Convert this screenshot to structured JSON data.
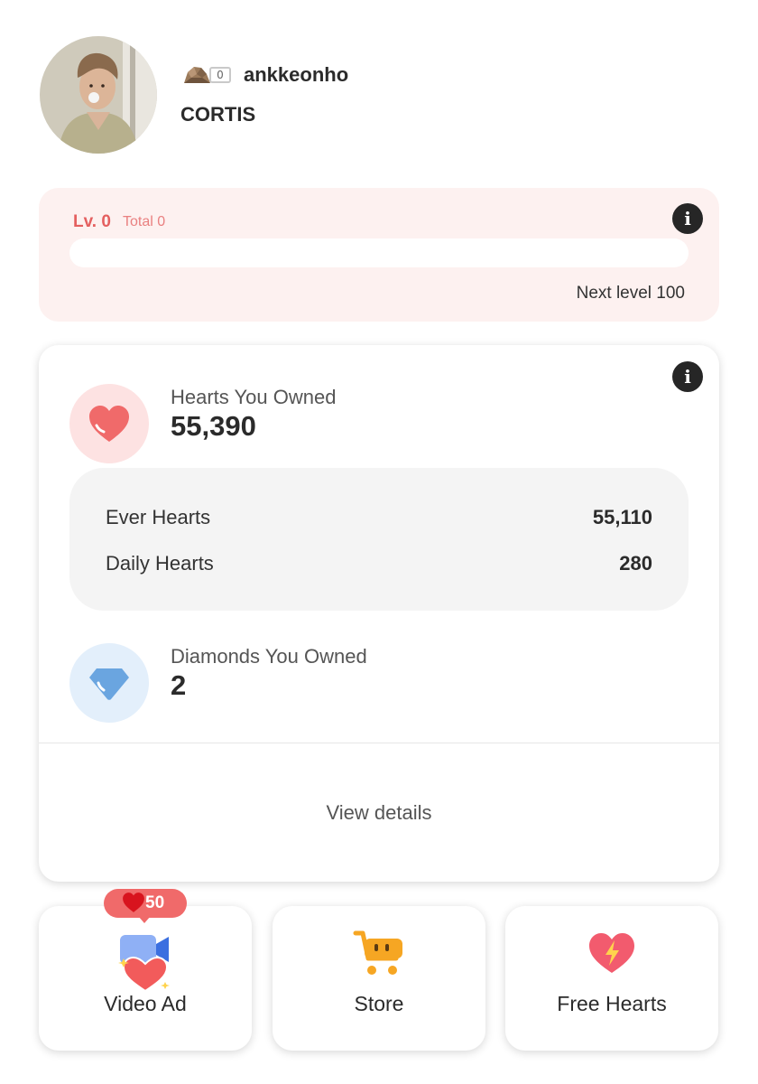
{
  "profile": {
    "username": "ankkeonho",
    "group": "CORTIS",
    "rank_count": "0",
    "rank_icon": "rock-icon"
  },
  "level": {
    "label": "Lv. 0",
    "total": "Total 0",
    "progress_fraction": 0,
    "next_level": "Next level 100"
  },
  "hearts": {
    "label": "Hearts You Owned",
    "value": "55,390",
    "breakdown": [
      {
        "name": "Ever Hearts",
        "value": "55,110"
      },
      {
        "name": "Daily Hearts",
        "value": "280"
      }
    ]
  },
  "diamonds": {
    "label": "Diamonds You Owned",
    "value": "2"
  },
  "view_details": "View details",
  "actions": {
    "video_ad": {
      "label": "Video Ad",
      "badge": "50"
    },
    "store": {
      "label": "Store"
    },
    "free_hearts": {
      "label": "Free Hearts"
    }
  },
  "colors": {
    "accent_red": "#f06a6a",
    "level_bg": "#fdf1f0",
    "diamond_blue": "#6aa5e0",
    "store_orange": "#f6a623"
  }
}
